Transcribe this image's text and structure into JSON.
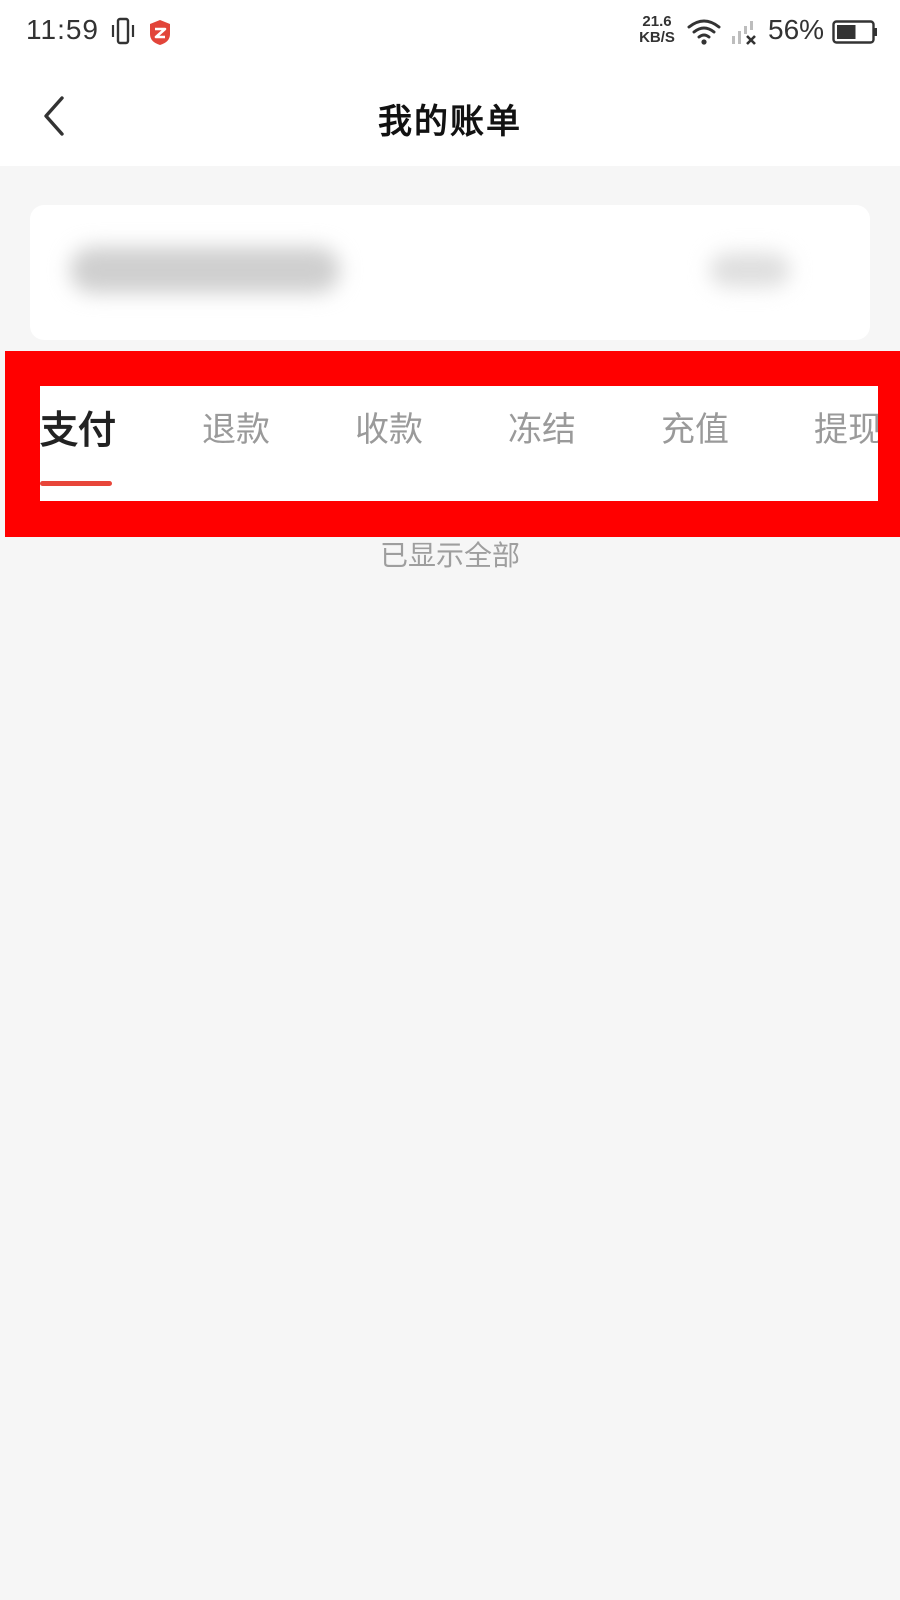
{
  "status_bar": {
    "time": "11:59",
    "net_speed_value": "21.6",
    "net_speed_unit": "KB/S",
    "battery_percent": "56%",
    "battery_level": 0.56,
    "icons": [
      "vibrate-icon",
      "app-badge-icon",
      "wifi-icon",
      "signal-icon",
      "battery-icon"
    ]
  },
  "header": {
    "title": "我的账单",
    "back_icon": "chevron-left-icon"
  },
  "tabs": [
    {
      "label": "支付",
      "active": true
    },
    {
      "label": "退款",
      "active": false
    },
    {
      "label": "收款",
      "active": false
    },
    {
      "label": "冻结",
      "active": false
    },
    {
      "label": "充值",
      "active": false
    },
    {
      "label": "提现",
      "active": false
    }
  ],
  "list": {
    "end_text": "已显示全部"
  },
  "colors": {
    "accent": "#e8463a",
    "highlight": "#ff0000",
    "background": "#f6f6f6",
    "inactive_tab": "#9a9a9a",
    "active_tab": "#222222"
  }
}
